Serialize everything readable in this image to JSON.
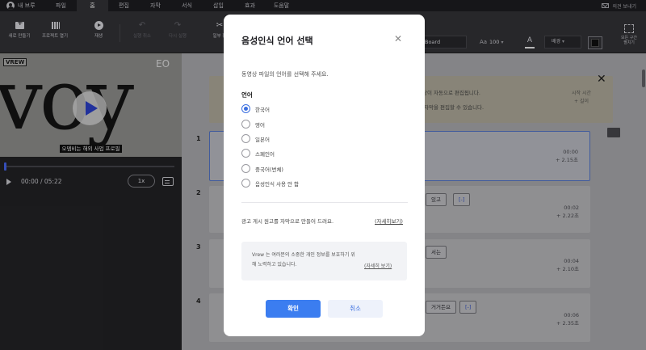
{
  "menubar": {
    "user": "내 브루",
    "items": [
      "파일",
      "홈",
      "편집",
      "자막",
      "서식",
      "삽입",
      "효과",
      "도움말"
    ],
    "active_index": 1,
    "feedback": "의견 보내기"
  },
  "toolbar": {
    "new_project": "새로 만들기",
    "open_project": "프로젝트 열기",
    "play": "재생",
    "undo": "실행 취소",
    "redo": "다시 실행",
    "partial": "일부 편",
    "font": "Board",
    "font_size_icon": "Aa",
    "font_size": "100",
    "text_color_glyph": "A",
    "background": "배경",
    "expand_label_1": "모든 구간",
    "expand_label_2": "펼치기"
  },
  "player": {
    "big_text": "voy",
    "logo": "VREW",
    "brand_mark": "EO",
    "subtitle": "오뎀비는 해외 사업 프로필",
    "time": "00:00 / 05:22",
    "speed": "1x"
  },
  "editor": {
    "notice_line_1": "영상이 자동으로 편집됩니다.",
    "notice_line_2": "시 자막을 편집할 수 있습니다.",
    "notice_right_1": "시작 시간",
    "notice_right_2": "+ 길이",
    "rows": [
      {
        "num": "1",
        "time": "00:00",
        "dur": "+ 2.15초"
      },
      {
        "num": "2",
        "time": "00:02",
        "dur": "+ 2.22초",
        "words": [
          "있고",
          "[-]"
        ]
      },
      {
        "num": "3",
        "time": "00:04",
        "dur": "+ 2.10초",
        "words": [
          "서는"
        ]
      },
      {
        "num": "4",
        "time": "00:06",
        "dur": "+ 2.35초",
        "words": [
          "거거든요",
          "[-]"
        ]
      }
    ]
  },
  "dialog": {
    "title": "음성인식 언어 선택",
    "close": "✕",
    "description": "동영상 파일의 언어를 선택해 주세요.",
    "language_label": "언어",
    "options": [
      "한국어",
      "영어",
      "일본어",
      "스페인어",
      "중국어(번체)",
      "음성인식 사용 안 함"
    ],
    "selected_index": 0,
    "ad_text": "광고 게시 원고를 자막으로 만들어 드려요.",
    "ad_link": "(자세히보기)",
    "privacy_text": "Vrew 는 여러분의 소중한 개인 정보를 보호하기 위해 노력하고 있습니다.",
    "privacy_link": "(자세히 보기)",
    "confirm": "확인",
    "cancel": "취소"
  },
  "colors": {
    "accent": "#3b7df0",
    "dialog_bg": "#ffffff",
    "app_dark": "#2a2a2e"
  }
}
